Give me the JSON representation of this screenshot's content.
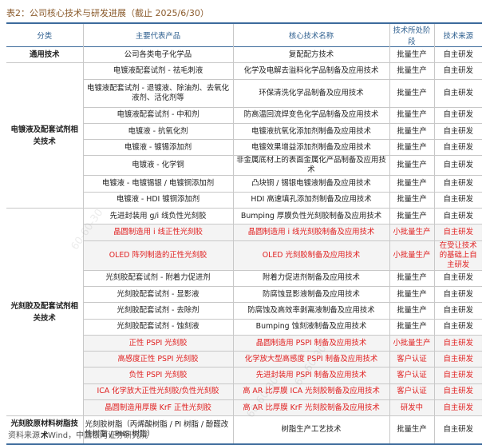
{
  "caption": "表2：公司核心技术与研发进展（截止 2025/6/30）",
  "source": "资料来源：Wind，中国银河证券研究院",
  "watermark": "60-60-30",
  "headers": [
    "分类",
    "主要代表产品",
    "核心技术名称",
    "技术所处阶段",
    "技术来源"
  ],
  "groups": [
    {
      "category": "通用技术",
      "rows": [
        {
          "product": "公司各类电子化学品",
          "tech": "复配配方技术",
          "stage": "批量生产",
          "source": "自主研发"
        }
      ]
    },
    {
      "category": "电镀液及配套试剂相关技术",
      "rows": [
        {
          "product": "电镀液配套试剂 - 祛毛刺液",
          "tech": "化学及电解去溢料化学品制备及应用技术",
          "stage": "批量生产",
          "source": "自主研发"
        },
        {
          "product": "电镀液配套试剂 - 退镀液、除油剂、去氧化液剂、活化剂等",
          "tech": "环保清洗化学品制备及应用技术",
          "stage": "批量生产",
          "source": "自主研发",
          "tall": true
        },
        {
          "product": "电镀液配套试剂 - 中和剂",
          "tech": "防高温回流焊变色化学品制备及应用技术",
          "stage": "批量生产",
          "source": "自主研发"
        },
        {
          "product": "电镀液 - 抗氧化剂",
          "tech": "电镀液抗氧化添加剂制备及应用技术",
          "stage": "批量生产",
          "source": "自主研发"
        },
        {
          "product": "电镀液 - 镀锡添加剂",
          "tech": "电镀效果增益添加剂制备及应用技术",
          "stage": "批量生产",
          "source": "自主研发"
        },
        {
          "product": "电镀液 - 化学铜",
          "tech": "非金属底材上的表面金属化产品制备及应用技术",
          "stage": "批量生产",
          "source": "自主研发"
        },
        {
          "product": "电镀液 - 电镀锡银 / 电镀铜添加剂",
          "tech": "凸块铜 / 锡银电镀液制备及应用技术",
          "stage": "批量生产",
          "source": "自主研发"
        },
        {
          "product": "电镀液 - HDI 镀铜添加剂",
          "tech": "HDI 高速填孔添加剂制备及应用技术",
          "stage": "批量生产",
          "source": "自主研发"
        }
      ]
    },
    {
      "category": "光刻胶及配套试剂相关技术",
      "rows": [
        {
          "product": "先进封装用 g/i 线负性光刻胶",
          "tech": "Bumping 厚膜负性光刻胶制备及应用技术",
          "stage": "批量生产",
          "source": "自主研发"
        },
        {
          "product": "晶圆制造用 i 线正性光刻胶",
          "tech": "晶圆制造用 i 线光刻胶制备及应用技术",
          "stage": "小批量生产",
          "source": "自主研发",
          "red": true
        },
        {
          "product": "OLED 阵列制造的正性光刻胶",
          "tech": "OLED 光刻胶制备及应用技术",
          "stage": "小批量生产",
          "source": "在受让技术的基础上自主研发",
          "red": true,
          "tall": true
        },
        {
          "product": "光刻胶配套试剂 - 附着力促进剂",
          "tech": "附着力促进剂制备及应用技术",
          "stage": "批量生产",
          "source": "自主研发"
        },
        {
          "product": "光刻胶配套试剂 - 显影液",
          "tech": "防腐蚀显影液制备及应用技术",
          "stage": "批量生产",
          "source": "自主研发"
        },
        {
          "product": "光刻胶配套试剂 - 去除剂",
          "tech": "防腐蚀及高效率剥离液制备及应用技术",
          "stage": "批量生产",
          "source": "自主研发"
        },
        {
          "product": "光刻胶配套试剂 - 蚀刻液",
          "tech": "Bumping 蚀刻液制备及应用技术",
          "stage": "批量生产",
          "source": "自主研发"
        },
        {
          "product": "正性 PSPI 光刻胶",
          "tech": "晶圆制造用 PSPI 制备及应用技术",
          "stage": "小批量生产",
          "source": "自主研发",
          "red": true
        },
        {
          "product": "高感度正性 PSPI 光刻胶",
          "tech": "化学放大型高感度 PSPI 制备及应用技术",
          "stage": "客户认证",
          "source": "自主研发",
          "red": true
        },
        {
          "product": "负性 PSPI 光刻胶",
          "tech": "先进封装用 PSPI 制备及应用技术",
          "stage": "客户认证",
          "source": "自主研发",
          "red": true
        },
        {
          "product": "ICA 化学放大正性光刻胶/负性光刻胶",
          "tech": "高 AR 比厚膜 ICA 光刻胶制备及应用技术",
          "stage": "客户认证",
          "source": "自主研发",
          "red": true
        },
        {
          "product": "晶圆制造用厚膜 KrF 正性光刻胶",
          "tech": "高 AR 比厚膜 KrF 光刻胶制备及应用技术",
          "stage": "研发中",
          "source": "自主研发",
          "red": true
        }
      ]
    },
    {
      "category": "光刻胶原材料树脂技术",
      "rows": [
        {
          "product": "光刻胶树脂（丙烯酸树脂 / PI 树脂 / 酚醛改性树脂 / PHS 树脂）",
          "tech": "树脂生产工艺技术",
          "stage": "批量生产",
          "source": "自主研发",
          "tall": true,
          "left": true
        }
      ]
    }
  ]
}
